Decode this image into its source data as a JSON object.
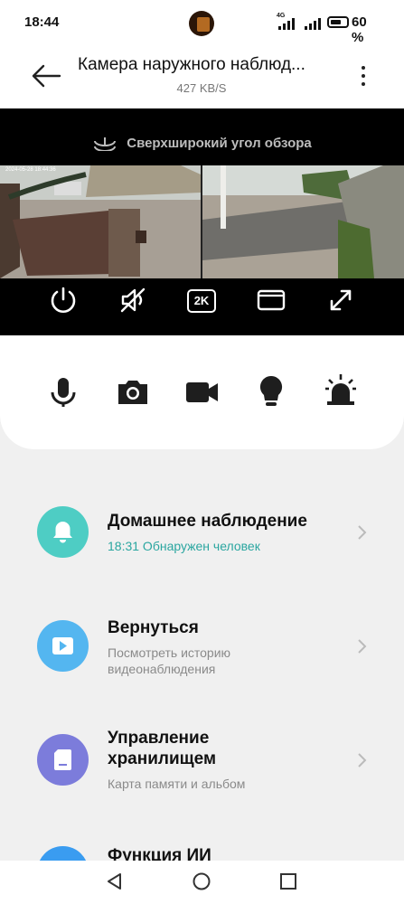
{
  "status_bar": {
    "time": "18:44",
    "network": "4G",
    "battery": "60 %",
    "battery_level": 0.6
  },
  "header": {
    "title": "Камера наружного наблюд...",
    "subtitle": "427 KB/S"
  },
  "video": {
    "label": "Сверхширокий угол обзора",
    "timestamp": "2024-05-28 18:44:36",
    "controls": [
      "power-icon",
      "mute-icon",
      "resolution-2k",
      "screen-layout-icon",
      "fullscreen-icon"
    ],
    "resolution_label": "2K"
  },
  "actions": [
    "microphone-icon",
    "camera-icon",
    "video-icon",
    "light-bulb-icon",
    "alarm-icon"
  ],
  "menu": [
    {
      "title": "Домашнее наблюдение",
      "subtitle": "18:31 Обнаружен человек",
      "icon": "bell-icon",
      "color": "#4ecdc4"
    },
    {
      "title": "Вернуться",
      "subtitle_line1": "Посмотреть историю",
      "subtitle_line2": "видеонаблюдения",
      "icon": "play-icon",
      "color": "#54b6f0"
    },
    {
      "title_line1": "Управление",
      "title_line2": "хранилищем",
      "subtitle": "Карта памяти и альбом",
      "icon": "sd-card-icon",
      "color": "#7c7cdb"
    },
    {
      "title": "Функция ИИ",
      "icon": "ai-icon",
      "color": "#3a9cf0"
    }
  ],
  "colors": {
    "accent_teal": "#2aa6a0"
  }
}
